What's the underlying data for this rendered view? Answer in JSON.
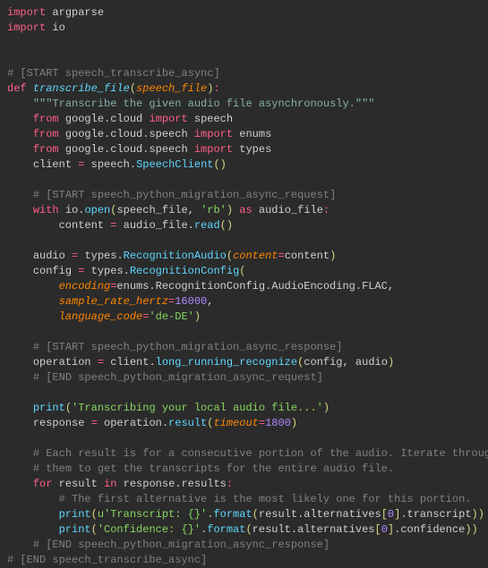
{
  "l": {
    "0": {
      "a": "import",
      "b": "argparse"
    },
    "1": {
      "a": "import",
      "b": "io"
    },
    "4": "# [START speech_transcribe_async]",
    "5": {
      "a": "def",
      "b": "transcribe_file",
      "c": "speech_file"
    },
    "6": "\"\"\"Transcribe the given audio file asynchronously.\"\"\"",
    "7": {
      "a": "from",
      "b": "google.cloud",
      "c": "import",
      "d": "speech"
    },
    "8": {
      "a": "from",
      "b": "google.cloud.speech",
      "c": "import",
      "d": "enums"
    },
    "9": {
      "a": "from",
      "b": "google.cloud.speech",
      "c": "import",
      "d": "types"
    },
    "10": {
      "a": "client",
      "b": "speech",
      "c": "SpeechClient"
    },
    "12": "# [START speech_python_migration_async_request]",
    "13": {
      "a": "with",
      "b": "io",
      "c": "open",
      "d": "speech_file",
      "e": "'rb'",
      "f": "as",
      "g": "audio_file"
    },
    "14": {
      "a": "content",
      "b": "audio_file",
      "c": "read"
    },
    "16": {
      "a": "audio",
      "b": "types",
      "c": "RecognitionAudio",
      "d": "content",
      "e": "content"
    },
    "17": {
      "a": "config",
      "b": "types",
      "c": "RecognitionConfig"
    },
    "18": {
      "a": "encoding",
      "b": "enums.RecognitionConfig.AudioEncoding.FLAC"
    },
    "19": {
      "a": "sample_rate_hertz",
      "b": "16000"
    },
    "20": {
      "a": "language_code",
      "b": "'de-DE'"
    },
    "22": "# [START speech_python_migration_async_response]",
    "23": {
      "a": "operation",
      "b": "client",
      "c": "long_running_recognize",
      "d": "config",
      "e": "audio"
    },
    "24": "# [END speech_python_migration_async_request]",
    "26": {
      "a": "print",
      "b": "'Transcribing your local audio file...'"
    },
    "27": {
      "a": "response",
      "b": "operation",
      "c": "result",
      "d": "timeout",
      "e": "1800"
    },
    "29": "# Each result is for a consecutive portion of the audio. Iterate through",
    "30": "# them to get the transcripts for the entire audio file.",
    "31": {
      "a": "for",
      "b": "result",
      "c": "in",
      "d": "response.results"
    },
    "32": "# The first alternative is the most likely one for this portion.",
    "33": {
      "a": "print",
      "b": "u'Transcript: {}'",
      "c": "format",
      "d": "result.alternatives",
      "e": "0",
      "f": "transcript"
    },
    "34": {
      "a": "print",
      "b": "'Confidence: {}'",
      "c": "format",
      "d": "result.alternatives",
      "e": "0",
      "f": "confidence"
    },
    "35": "# [END speech_python_migration_async_response]",
    "36": "# [END speech_transcribe_async]"
  }
}
